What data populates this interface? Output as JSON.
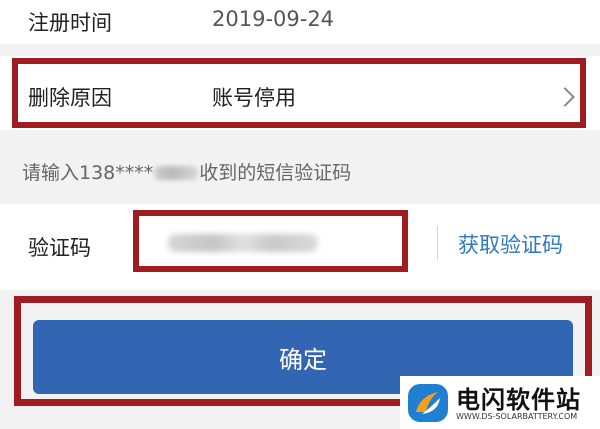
{
  "form": {
    "register_time": {
      "label": "注册时间",
      "value": "2019-09-24"
    },
    "delete_reason": {
      "label": "删除原因",
      "value": "账号停用"
    },
    "sms_hint": {
      "prefix": "请输入138****",
      "suffix": "收到的短信验证码"
    },
    "verify_code": {
      "label": "验证码",
      "get_code_label": "获取验证码"
    },
    "confirm_label": "确定"
  },
  "watermark": {
    "title": "电闪软件站",
    "url": "WWW.DS-SOLARBATTERY.COM"
  },
  "colors": {
    "highlight": "#a01c23",
    "primary_button": "#3266b3",
    "link": "#2f78c6",
    "background": "#f2f2f2"
  }
}
